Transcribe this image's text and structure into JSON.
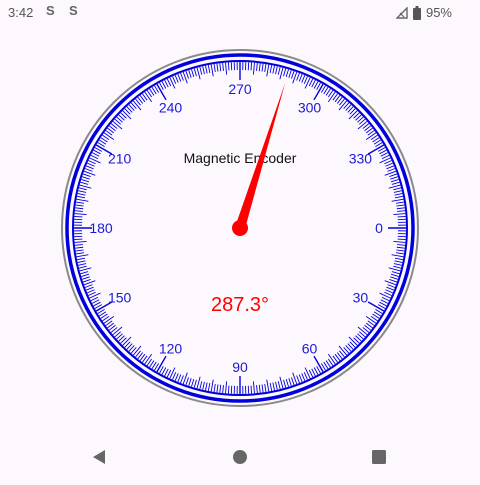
{
  "status_bar": {
    "time": "3:42",
    "notification_icons": [
      "S",
      "S"
    ],
    "battery_percent": "95%",
    "signal_icon": "signal-no-data-icon",
    "battery_icon": "battery-icon"
  },
  "gauge": {
    "title": "Magnetic Encoder",
    "value_text": "287.3°",
    "value_deg": 287.3,
    "tick_labels": [
      "0",
      "30",
      "60",
      "90",
      "120",
      "150",
      "180",
      "210",
      "240",
      "270",
      "300",
      "330"
    ],
    "colors": {
      "dial": "#0000dd",
      "outer_ring": "#8a8a8a",
      "needle": "#ff0000",
      "labels": "#1a1ad6"
    }
  },
  "nav_bar": {
    "icons": [
      "back-icon",
      "home-icon",
      "recents-icon"
    ]
  }
}
